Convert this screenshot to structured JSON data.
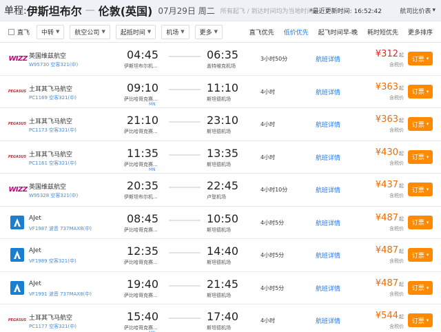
{
  "header": {
    "route_prefix": "单程:",
    "from_city": "伊斯坦布尔",
    "dash": "—",
    "to_city": "伦敦(英国)",
    "date": "07月29日 周二",
    "note": "所有起飞 / 到达时间均为当地时间",
    "update": "*最近更新时间: 16:52:42",
    "compare": "航司比价表"
  },
  "filter": {
    "direct": "直飞",
    "transfer": "中转",
    "airline": "航空公司",
    "dep_time": "起抵时间",
    "airport": "机场",
    "more": "更多",
    "sorts": [
      "直飞优先",
      "低价优先",
      "起飞时间早-晚",
      "耗时短优先",
      "更多排序"
    ]
  },
  "book_label": "订票",
  "detail_label": "航班详情",
  "price_unit": "起",
  "tax_label": "含税价",
  "flights": [
    {
      "logo": "wizz",
      "airline": "英国维兹航空",
      "flightno": "W95730 空客321(中)",
      "dep": "04:45",
      "dep_ap": "伊斯坦布尔机...",
      "arr": "06:35",
      "arr_ap": "盖特维克机场",
      "dur": "3小时50分",
      "price": "¥312",
      "red": true,
      "mn": ""
    },
    {
      "logo": "pegasus",
      "airline": "土耳其飞马航空",
      "flightno": "PC1169 空客321(中)",
      "dep": "09:10",
      "dep_ap": "萨比哈哥克赛...",
      "arr": "11:10",
      "arr_ap": "斯坦德机场",
      "dur": "4小时",
      "price": "¥363",
      "red": false,
      "mn": "MN"
    },
    {
      "logo": "pegasus",
      "airline": "土耳其飞马航空",
      "flightno": "PC1173 空客321(中)",
      "dep": "21:10",
      "dep_ap": "萨比哈哥克赛...",
      "arr": "23:10",
      "arr_ap": "斯坦德机场",
      "dur": "4小时",
      "price": "¥363",
      "red": false,
      "mn": ""
    },
    {
      "logo": "pegasus",
      "airline": "土耳其飞马航空",
      "flightno": "PC1161 空客321(中)",
      "dep": "11:35",
      "dep_ap": "萨比哈哥克赛...",
      "arr": "13:35",
      "arr_ap": "斯坦德机场",
      "dur": "4小时",
      "price": "¥430",
      "red": false,
      "mn": "MN"
    },
    {
      "logo": "wizz",
      "airline": "英国维兹航空",
      "flightno": "W95328 空客321(中)",
      "dep": "20:35",
      "dep_ap": "伊斯坦布尔机...",
      "arr": "22:45",
      "arr_ap": "卢登机场",
      "dur": "4小时10分",
      "price": "¥437",
      "red": false,
      "mn": ""
    },
    {
      "logo": "ajet",
      "airline": "AJet",
      "flightno": "VF1987 波音 737MAX8(中)",
      "dep": "08:45",
      "dep_ap": "萨比哈哥克赛...",
      "arr": "10:50",
      "arr_ap": "斯坦德机场",
      "dur": "4小时5分",
      "price": "¥487",
      "red": false,
      "mn": ""
    },
    {
      "logo": "ajet",
      "airline": "AJet",
      "flightno": "VF1989 空客321(中)",
      "dep": "12:35",
      "dep_ap": "萨比哈哥克赛...",
      "arr": "14:40",
      "arr_ap": "斯坦德机场",
      "dur": "4小时5分",
      "price": "¥487",
      "red": false,
      "mn": ""
    },
    {
      "logo": "ajet",
      "airline": "AJet",
      "flightno": "VF1991 波音 737MAX8(中)",
      "dep": "19:40",
      "dep_ap": "萨比哈哥克赛...",
      "arr": "21:45",
      "arr_ap": "斯坦德机场",
      "dur": "4小时5分",
      "price": "¥487",
      "red": false,
      "mn": ""
    },
    {
      "logo": "pegasus",
      "airline": "土耳其飞马航空",
      "flightno": "PC1177 空客321(中)",
      "dep": "15:40",
      "dep_ap": "萨比哈哥克赛...",
      "arr": "17:40",
      "arr_ap": "斯坦德机场",
      "dur": "4小时",
      "price": "¥544",
      "red": false,
      "mn": "MN"
    }
  ],
  "logo_text": {
    "wizz": "WIZZ",
    "pegasus": "PEGASUS"
  },
  "colors": {
    "accent": "#2577e3",
    "book": "#ff8a00",
    "price": "#f06b00",
    "price_low": "#e0262a"
  }
}
